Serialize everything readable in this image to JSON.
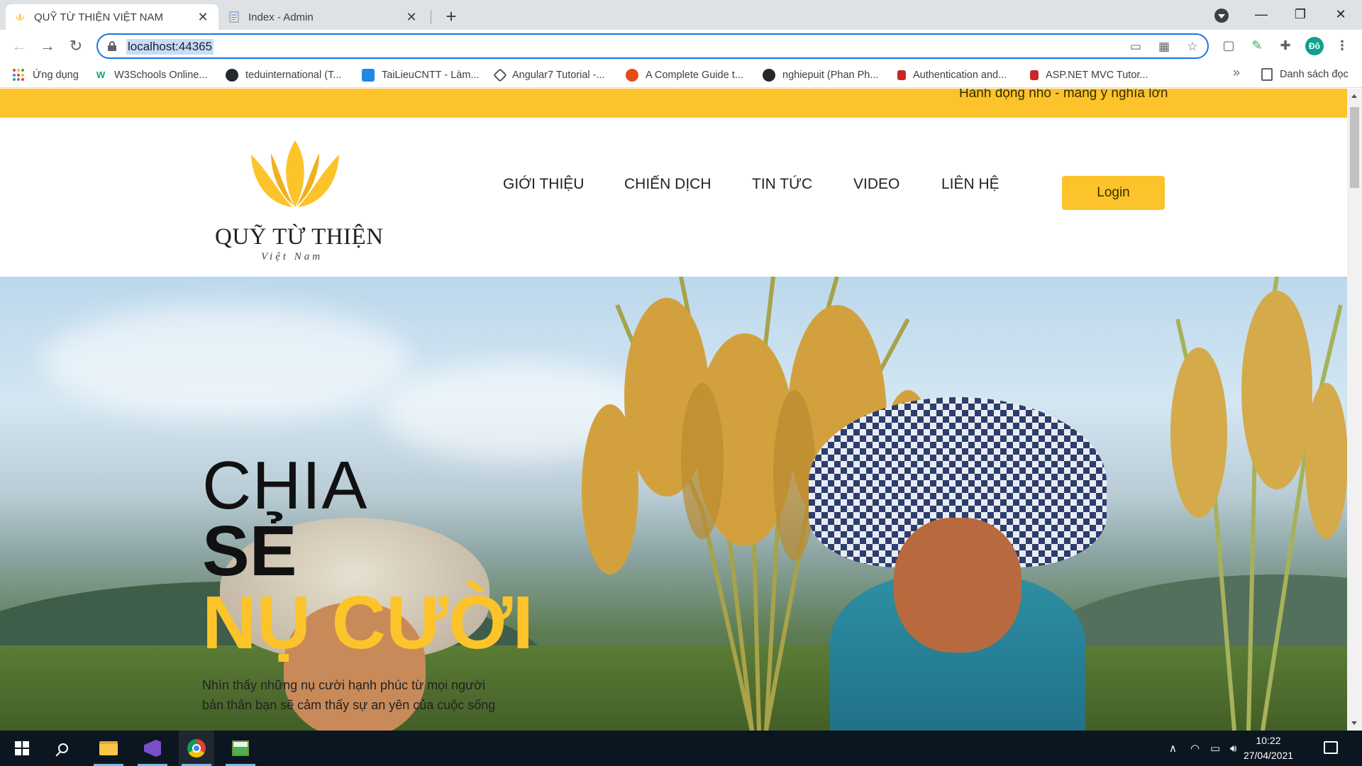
{
  "browser": {
    "tabs": [
      {
        "title": "QUỸ TỪ THIỆN VIỆT NAM",
        "active": true
      },
      {
        "title": "Index - Admin",
        "active": false
      }
    ],
    "url": "localhost:44365",
    "profile_initials": "Đô",
    "bookmarks": [
      {
        "label": "Ứng dụng",
        "icon": "apps-grid-icon"
      },
      {
        "label": "W3Schools Online...",
        "icon": "w3schools-icon"
      },
      {
        "label": "teduinternational (T...",
        "icon": "github-icon"
      },
      {
        "label": "TaiLieuCNTT - Làm...",
        "icon": "tailieucntt-icon"
      },
      {
        "label": "Angular7 Tutorial -...",
        "icon": "angular-icon"
      },
      {
        "label": "A Complete Guide t...",
        "icon": "guide-icon"
      },
      {
        "label": "nghiepuit (Phan Ph...",
        "icon": "github-icon"
      },
      {
        "label": "Authentication and...",
        "icon": "auth0-icon"
      },
      {
        "label": "ASP.NET MVC Tutor...",
        "icon": "aspnet-icon"
      }
    ],
    "more_bookmarks": "»",
    "reading_list": "Danh sách đọc"
  },
  "site": {
    "slogan": "Hành động nhỏ - mang ý nghĩa lớn",
    "logo": {
      "name": "QUỸ TỪ THIỆN",
      "subtitle": "Việt Nam"
    },
    "nav": [
      "GIỚI THIỆU",
      "CHIẾN DỊCH",
      "TIN TỨC",
      "VIDEO",
      "LIÊN HỆ"
    ],
    "login_label": "Login",
    "hero": {
      "line1": "CHIA",
      "line2": "SẺ",
      "line3": "NỤ CƯỜI",
      "desc1": "Nhìn thấy những nụ cười hạnh phúc từ mọi người",
      "desc2": "bản thân bạn sẽ cảm thấy sự an yên của cuộc sống"
    },
    "brand_color": "#fcc42a"
  },
  "taskbar": {
    "apps": [
      "windows-start-icon",
      "search-icon",
      "file-explorer-icon",
      "visual-studio-icon",
      "chrome-icon",
      "image-viewer-icon"
    ],
    "time": "10:22",
    "date": "27/04/2021"
  }
}
